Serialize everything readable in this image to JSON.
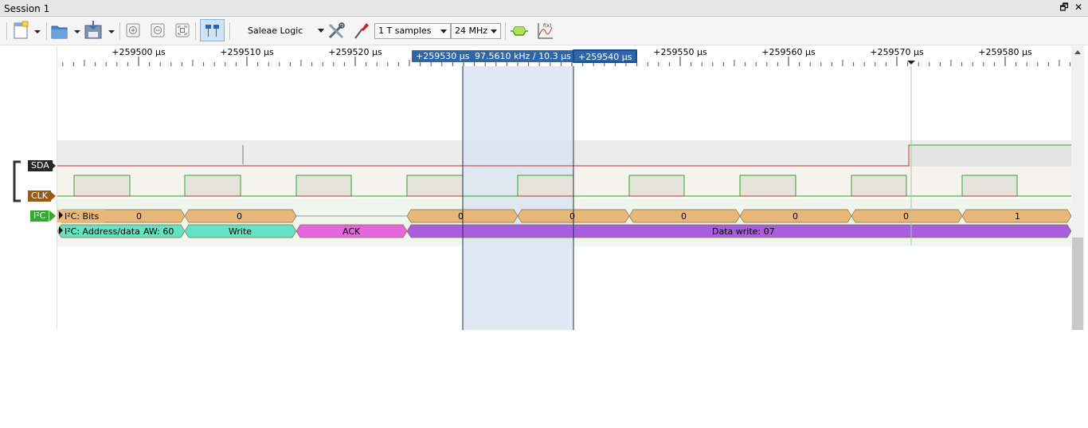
{
  "window": {
    "title": "Session 1",
    "restore_glyph": "🗗",
    "close_glyph": "✕"
  },
  "toolbar": {
    "device": "Saleae Logic",
    "samples": "1 T samples",
    "rate": "24 MHz",
    "icons": [
      "new-document-icon",
      "open-folder-icon",
      "save-icon",
      "zoom-in-icon",
      "zoom-out-icon",
      "zoom-fit-icon",
      "cursor-link-icon",
      "device-settings-icon",
      "trigger-probe-icon",
      "analyzer-icon",
      "function-plot-icon"
    ]
  },
  "timeline": {
    "ticks": [
      "+259500 µs",
      "+259510 µs",
      "+259520 µs",
      "+259530 µs",
      "+259540 µs",
      "+259550 µs",
      "+259560 µs",
      "+259570 µs",
      "+259580 µs"
    ],
    "marker_a": "+259530 µs",
    "marker_b": "+259540 µs",
    "measurement": "97.5610 kHz / 10.3 µs"
  },
  "channels": {
    "sda": "SDA",
    "clk": "CLK",
    "i2c": "I²C"
  },
  "analyzers": {
    "bits_title": "I²C: Bits",
    "bits": [
      "0",
      "0",
      "0",
      "0",
      "0",
      "0",
      "0",
      "1"
    ],
    "addr_title": "I²C: Address/data",
    "addr_items": [
      {
        "label": "AW: 60",
        "color": "#63e3c4"
      },
      {
        "label": "Write",
        "color": "#63e3c4"
      },
      {
        "label": "ACK",
        "color": "#e566dc"
      },
      {
        "label": "Data write: 07",
        "color": "#a75fe0"
      }
    ]
  },
  "colors": {
    "sda_line": "#c0392b",
    "clk_line": "#2aa52a",
    "bits_fill": "#e8b87a",
    "marker": "#2f66a8",
    "selection": "#dbe5f1"
  }
}
